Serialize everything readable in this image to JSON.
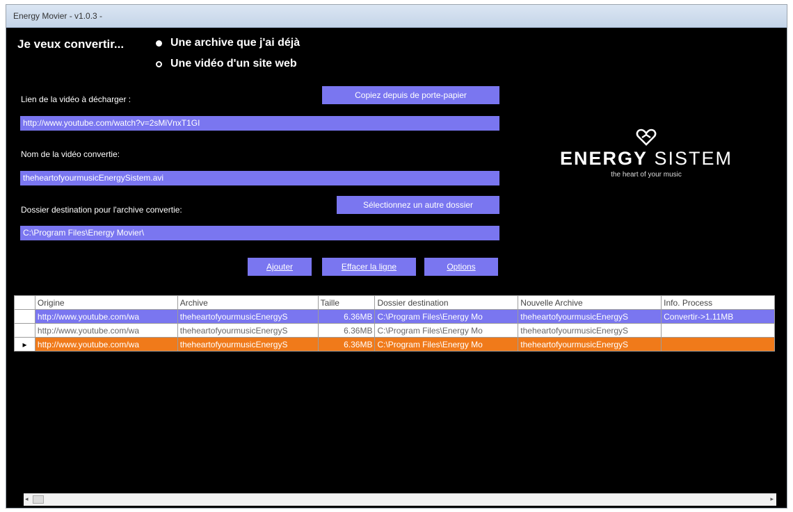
{
  "window": {
    "title": "Energy Movier - v1.0.3 -"
  },
  "form": {
    "heading": "Je veux convertir...",
    "radio_options": [
      {
        "label": "Une archive que j'ai déjà",
        "selected": true
      },
      {
        "label": "Une vidéo d'un site web",
        "selected": false
      }
    ],
    "video_link_label": "Lien de la vidéo à décharger :",
    "paste_button": "Copiez depuis de porte-papier",
    "video_link_value": "http://www.youtube.com/watch?v=2sMiVnxT1GI",
    "converted_name_label": "Nom de la vidéo convertie:",
    "converted_name_value": "theheartofyourmusicEnergySistem.avi",
    "dest_folder_label": "Dossier destination pour l'archive convertie:",
    "select_folder_button": "Sélectionnez un autre dossier",
    "dest_folder_value": "C:\\Program Files\\Energy Movier\\",
    "add_button": "Ajouter",
    "delete_button": "Effacer la ligne",
    "options_button": "Options"
  },
  "logo": {
    "brand_bold": "ENERGY",
    "brand_light": "SISTEM",
    "tagline": "the heart of your music"
  },
  "table": {
    "columns": [
      "Origine",
      "Archive",
      "Taille",
      "Dossier destination",
      "Nouvelle Archive",
      "Info. Process"
    ],
    "rows": [
      {
        "marker": "",
        "origine": "http://www.youtube.com/wa",
        "archive": "theheartofyourmusicEnergyS",
        "taille": "6.36MB",
        "dossier": "C:\\Program Files\\Energy Mo",
        "nouvelle": "theheartofyourmusicEnergyS",
        "info": "Convertir->1.11MB"
      },
      {
        "marker": "",
        "origine": "http://www.youtube.com/wa",
        "archive": "theheartofyourmusicEnergyS",
        "taille": "6.36MB",
        "dossier": "C:\\Program Files\\Energy Mo",
        "nouvelle": "theheartofyourmusicEnergyS",
        "info": ""
      },
      {
        "marker": "▸",
        "origine": "http://www.youtube.com/wa",
        "archive": "theheartofyourmusicEnergyS",
        "taille": "6.36MB",
        "dossier": "C:\\Program Files\\Energy Mo",
        "nouvelle": "theheartofyourmusicEnergyS",
        "info": ""
      }
    ]
  },
  "colors": {
    "accent": "#7a76f0",
    "selected_row": "#f07a1a",
    "background": "#000000"
  }
}
